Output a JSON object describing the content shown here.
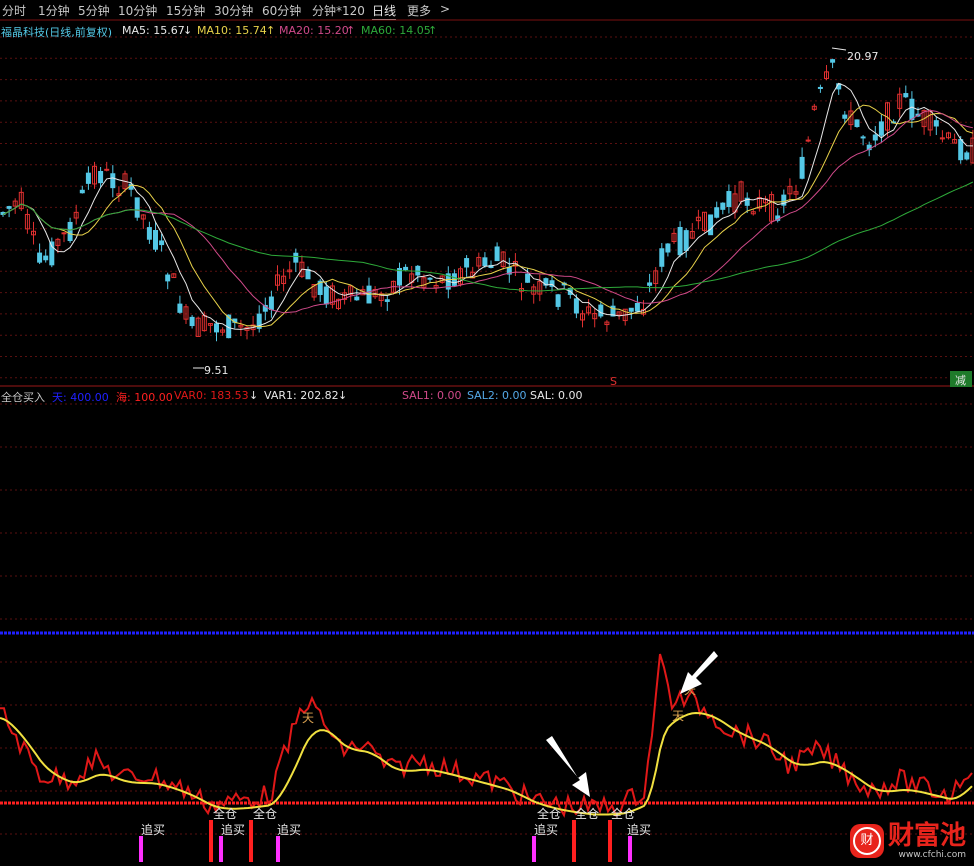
{
  "tabs": [
    "分时",
    "1分钟",
    "5分钟",
    "10分钟",
    "15分钟",
    "30分钟",
    "60分钟",
    "分钟*120",
    "日线",
    "更多"
  ],
  "active_tab": "日线",
  "more_chevron": ">",
  "main_legend": {
    "stock": "福晶科技(日线,前复权)",
    "ma5": "MA5: 15.67",
    "ma5_arrow": "↓",
    "ma10": "MA10: 15.74",
    "ma10_arrow": "↑",
    "ma20": "MA20: 15.20",
    "ma20_arrow": "↑",
    "ma60": "MA60: 14.05",
    "ma60_arrow": "↑"
  },
  "price_labels": {
    "high": "20.97",
    "low": "9.51",
    "marker_s": "S",
    "marker_jian": "减"
  },
  "indicator_legend": {
    "name": "全仓买入",
    "tian": "天: 400.00",
    "hai": "海: 100.00",
    "var0": "VAR0: 183.53",
    "var0_arrow": "↓",
    "var1": "VAR1: 202.82",
    "var1_arrow": "↓",
    "sal1": "SAL1: 0.00",
    "sal2": "SAL2: 0.00",
    "sal": "SAL: 0.00"
  },
  "signals": {
    "quancang": "全仓",
    "zhuimai": "追买",
    "tian_mark": "天"
  },
  "watermark": {
    "brand": "财富池",
    "url": "www.cfchi.com",
    "logo_char": "财"
  },
  "colors": {
    "up": "#e03030",
    "down": "#54c8e6",
    "ma5": "#e8e8e8",
    "ma10": "#e8d24a",
    "ma20": "#d04a8a",
    "ma60": "#2eaa3a",
    "blue_line": "#2020ff",
    "red_line": "#ff2020",
    "var0": "#e01818",
    "var1": "#f0e040",
    "signal_red": "#ff2020",
    "signal_magenta": "#ff30ff"
  }
}
